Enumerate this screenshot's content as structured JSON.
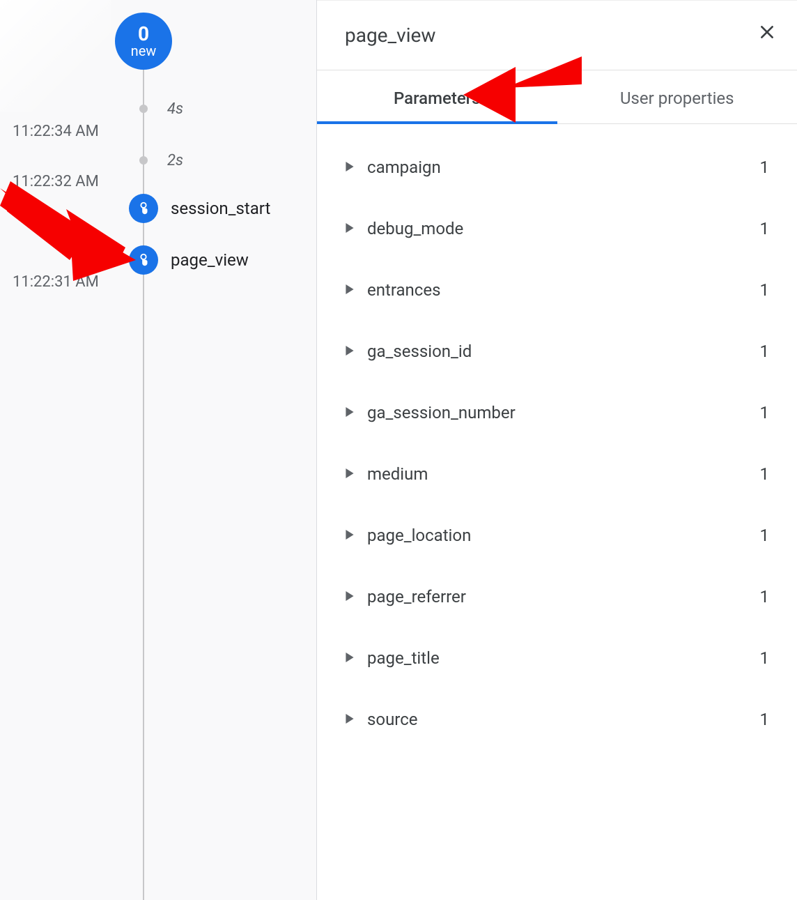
{
  "timeline": {
    "badge": {
      "count": "0",
      "label": "new"
    },
    "ticks": [
      {
        "label": "4s"
      },
      {
        "label": "2s"
      }
    ],
    "timestamps": [
      "11:22:34 AM",
      "11:22:32 AM",
      "11:22:31 AM"
    ],
    "events": [
      {
        "name": "session_start"
      },
      {
        "name": "page_view"
      }
    ]
  },
  "detail": {
    "title": "page_view",
    "tabs": {
      "parameters": "Parameters",
      "user_properties": "User properties",
      "active": "parameters"
    },
    "parameters": [
      {
        "name": "campaign",
        "count": "1"
      },
      {
        "name": "debug_mode",
        "count": "1"
      },
      {
        "name": "entrances",
        "count": "1"
      },
      {
        "name": "ga_session_id",
        "count": "1"
      },
      {
        "name": "ga_session_number",
        "count": "1"
      },
      {
        "name": "medium",
        "count": "1"
      },
      {
        "name": "page_location",
        "count": "1"
      },
      {
        "name": "page_referrer",
        "count": "1"
      },
      {
        "name": "page_title",
        "count": "1"
      },
      {
        "name": "source",
        "count": "1"
      }
    ]
  },
  "colors": {
    "accent": "#1a73e8",
    "annotation": "#f60000"
  }
}
